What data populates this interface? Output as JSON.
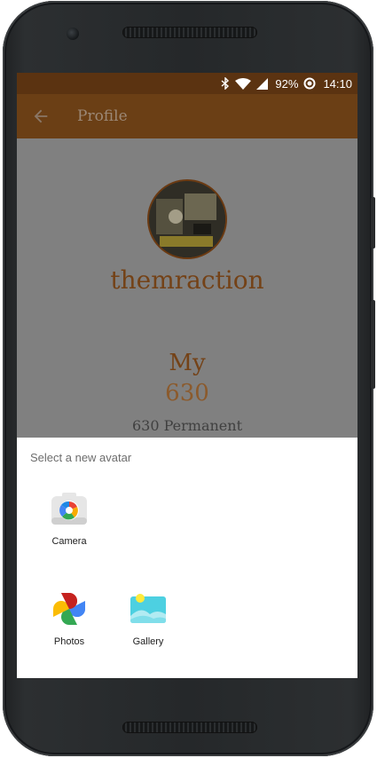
{
  "status_bar": {
    "battery": "92%",
    "time": "14:10",
    "icons": [
      "bluetooth-icon",
      "wifi-icon",
      "cell-signal-icon",
      "sync-icon"
    ]
  },
  "toolbar": {
    "back_icon": "arrow-back-icon",
    "title": "Profile"
  },
  "profile": {
    "username": "themraction",
    "my_label": "My",
    "count": "630",
    "permanent": "630 Permanent"
  },
  "sheet": {
    "title": "Select a new avatar",
    "apps": [
      {
        "label": "Camera",
        "icon": "camera-app-icon"
      },
      {
        "label": "Photos",
        "icon": "photos-app-icon"
      },
      {
        "label": "Gallery",
        "icon": "gallery-app-icon"
      }
    ]
  },
  "colors": {
    "status_bar": "#5b3311",
    "toolbar": "#6b3f15",
    "accent_text": "#744217",
    "scrim_bg": "#808080"
  }
}
